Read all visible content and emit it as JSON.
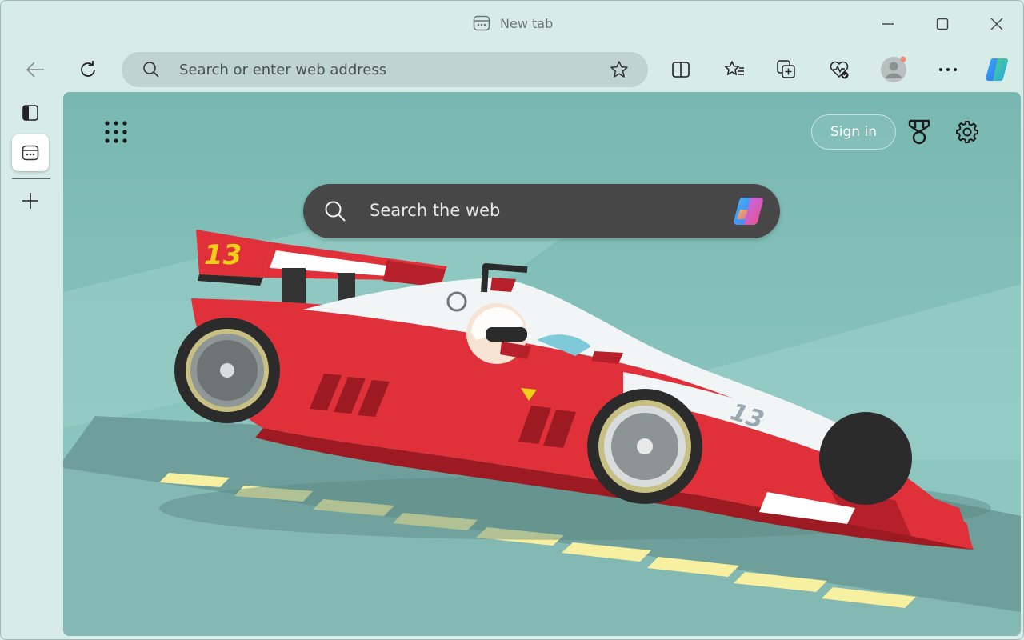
{
  "window": {
    "tab_title": "New tab",
    "controls": [
      "minimize",
      "maximize",
      "close"
    ]
  },
  "toolbar": {
    "address_placeholder": "Search or enter web address",
    "icons": [
      "back-icon",
      "refresh-icon",
      "search-icon",
      "star-icon",
      "split-screen-icon",
      "favorites-icon",
      "collections-icon",
      "browser-essentials-icon",
      "profile-avatar",
      "more-icon",
      "copilot-icon"
    ]
  },
  "sidebar": {
    "icons": [
      "tab-actions-icon",
      "new-tab-page-icon",
      "add-tab-icon"
    ]
  },
  "newtab": {
    "signin_label": "Sign in",
    "search_placeholder": "Search the web",
    "car_number": "13"
  },
  "colors": {
    "background": "#8ec7c0",
    "frame": "#d7ebe7",
    "address_bar": "#bfd3cf",
    "search_box": "#474747",
    "car_red": "#e0303a",
    "lane_marks": "#f7f0a0"
  }
}
